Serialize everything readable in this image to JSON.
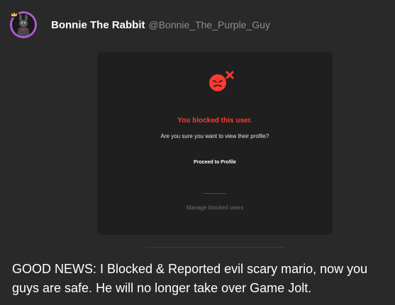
{
  "post": {
    "author_name": "Bonnie The Rabbit",
    "author_handle": "@Bonnie_The_Purple_Guy",
    "avatar_icon": "bonnie-avatar",
    "avatar_ring_color": "#b25bd6",
    "body": "GOOD NEWS: I Blocked & Reported evil scary mario, now you guys are safe. He will no longer take over Game Jolt."
  },
  "embed": {
    "icon": "blocked-user-icon",
    "accent_color": "#ff3b30",
    "title": "You blocked this user.",
    "question": "Are you sure you want to view their profile?",
    "proceed_label": "Proceed to Profile",
    "manage_label": "Manage blocked users"
  }
}
